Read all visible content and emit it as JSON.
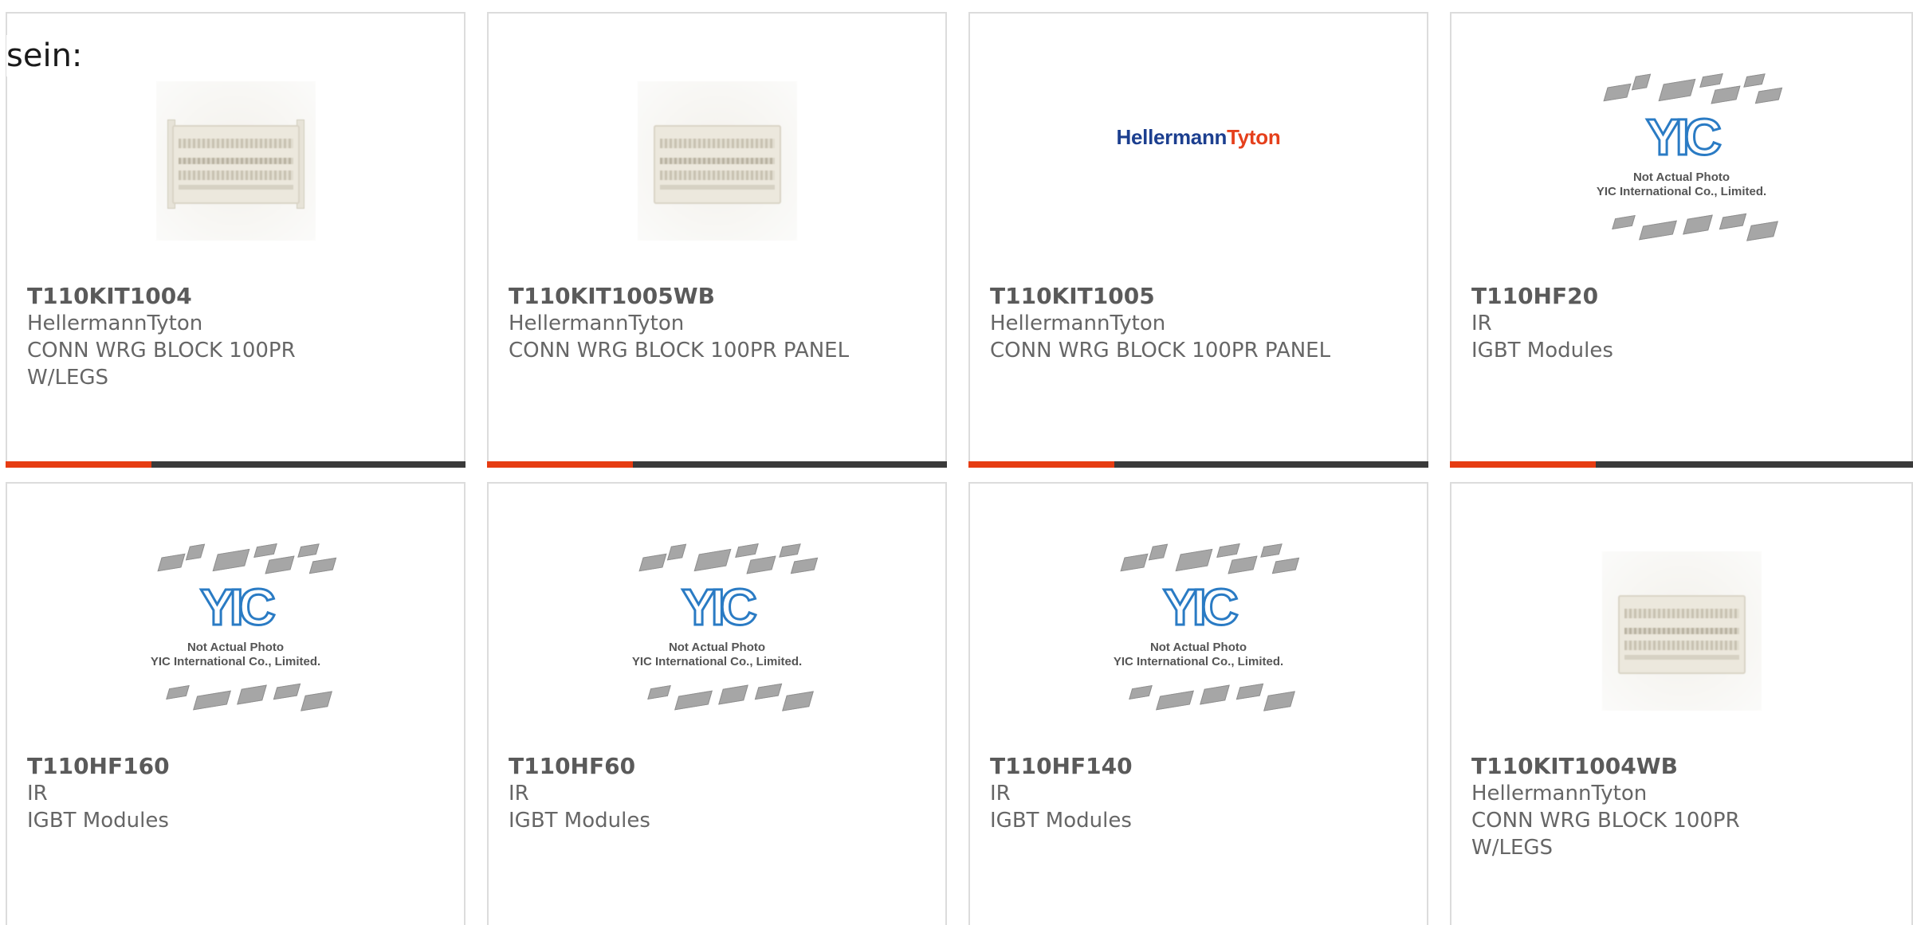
{
  "intro_text": "sein:",
  "colors": {
    "accent_bar": "#e63c12",
    "bar_base": "#3a3a3a",
    "card_border": "#dcdcdc",
    "text": "#666666",
    "logo_blue": "#1c3f8f",
    "logo_orange": "#e5401c",
    "yic_blue": "#2a7bc4"
  },
  "placeholder": {
    "mark": "YIC",
    "note_line1": "Not Actual Photo",
    "note_line2": "YIC International Co., Limited."
  },
  "logo": {
    "part1": "Hellermann",
    "part2": "Tyton"
  },
  "products": [
    {
      "part_number": "T110KIT1004",
      "manufacturer": "HellermannTyton",
      "desc_line1": "CONN WRG BLOCK 100PR",
      "desc_line2": "W/LEGS",
      "image": "terminal-block-photo"
    },
    {
      "part_number": "T110KIT1005WB",
      "manufacturer": "HellermannTyton",
      "desc_line1": "CONN WRG BLOCK 100PR PANEL",
      "desc_line2": "",
      "image": "terminal-block-photo"
    },
    {
      "part_number": "T110KIT1005",
      "manufacturer": "HellermannTyton",
      "desc_line1": "CONN WRG BLOCK 100PR PANEL",
      "desc_line2": "",
      "image": "hellermanntyton-logo"
    },
    {
      "part_number": "T110HF20",
      "manufacturer": "IR",
      "desc_line1": "IGBT Modules",
      "desc_line2": "",
      "image": "yic-placeholder"
    },
    {
      "part_number": "T110HF160",
      "manufacturer": "IR",
      "desc_line1": "IGBT Modules",
      "desc_line2": "",
      "image": "yic-placeholder"
    },
    {
      "part_number": "T110HF60",
      "manufacturer": "IR",
      "desc_line1": "IGBT Modules",
      "desc_line2": "",
      "image": "yic-placeholder"
    },
    {
      "part_number": "T110HF140",
      "manufacturer": "IR",
      "desc_line1": "IGBT Modules",
      "desc_line2": "",
      "image": "yic-placeholder"
    },
    {
      "part_number": "T110KIT1004WB",
      "manufacturer": "HellermannTyton",
      "desc_line1": "CONN WRG BLOCK 100PR",
      "desc_line2": "W/LEGS",
      "image": "terminal-block-photo"
    }
  ]
}
